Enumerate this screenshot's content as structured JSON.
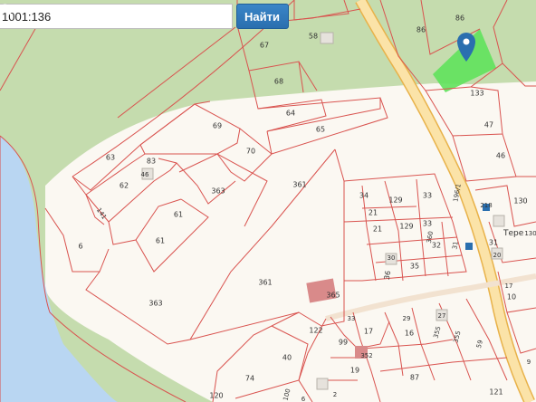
{
  "search": {
    "value": "1001:136",
    "button_label": "Найти"
  },
  "map": {
    "colors": {
      "water": "#b9d6f2",
      "forest": "#c5dcae",
      "plot_fill": "#fbf8f2",
      "boundary": "#d9534f",
      "road": "#fbe3a8",
      "road_edge": "#e8b24a",
      "highlight": "#5fe25c",
      "building": "#d98a8a",
      "marker": "#2a6faf"
    },
    "plot_labels": {
      "p86a": "86",
      "p86b": "86",
      "p87": "87",
      "p58": "58",
      "p67": "67",
      "p68": "68",
      "p133": "133",
      "p47": "47",
      "p46": "46",
      "p64": "64",
      "p65": "65",
      "p69": "69",
      "p70": "70",
      "p63": "63",
      "p83": "83",
      "p46b": "46",
      "p62": "62",
      "p141": "141",
      "p61a": "61",
      "p61b": "61",
      "p6": "6",
      "p363a": "363",
      "p363b": "363",
      "p361a": "361",
      "p361b": "361",
      "p34": "34",
      "p129a": "129",
      "p33a": "33",
      "p196": "196/1",
      "p21a": "21",
      "p21b": "21",
      "p129b": "129",
      "p33b": "33",
      "p360": "360",
      "p32": "32",
      "p31a": "31",
      "p30": "30",
      "p36": "36",
      "p35": "35",
      "p31b": "31",
      "p218": "218",
      "p130a": "130",
      "p130b": "130",
      "p20": "20",
      "p17a": "17",
      "p10": "10",
      "p365": "365",
      "p122": "122",
      "p33c": "33",
      "p17b": "17",
      "p29": "29",
      "p27": "27",
      "p99": "99",
      "p352": "352",
      "p16": "16",
      "p355a": "355",
      "p355b": "355",
      "p59": "59",
      "p19": "19",
      "p40": "40",
      "p74": "74",
      "p120": "120",
      "p100": "100",
      "p121": "121",
      "p9": "9",
      "p2": "2",
      "p6b": "6"
    },
    "place_label": "Тере"
  }
}
